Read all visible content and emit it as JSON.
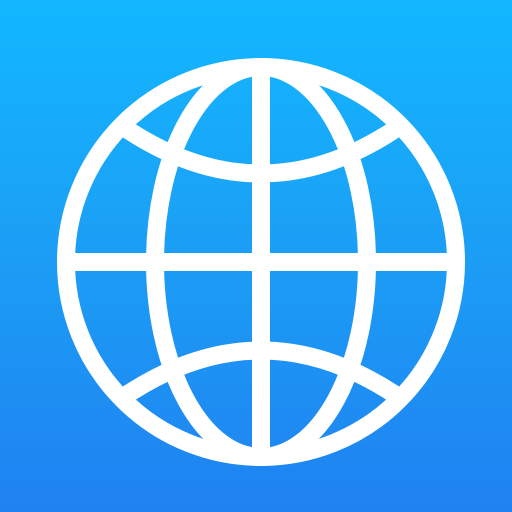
{
  "app": {
    "icon_name": "globe-icon",
    "background_top": "#12b8ff",
    "background_mid": "#1ba0f6",
    "background_bottom": "#1f82f1",
    "foreground": "#ffffff"
  }
}
